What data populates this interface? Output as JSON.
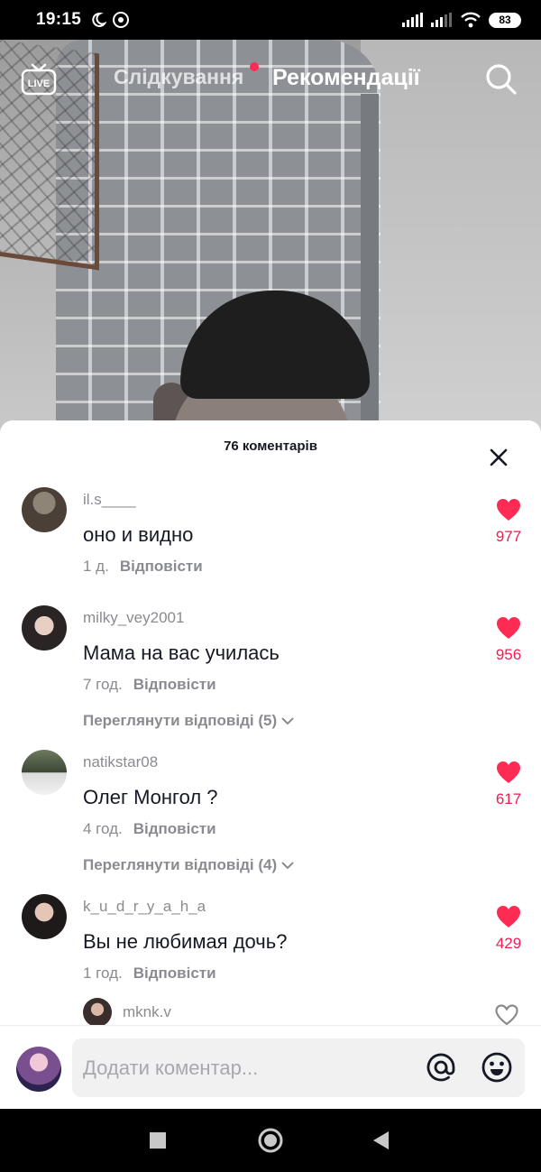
{
  "status_bar": {
    "time": "19:15",
    "battery": "83"
  },
  "feed": {
    "live_label": "LIVE",
    "tab_following": "Слідкування",
    "tab_for_you": "Рекомендації"
  },
  "comments_sheet": {
    "title": "76 коментарів",
    "comments": [
      {
        "username": "il.s____",
        "text": "оно и видно",
        "time": "1 д.",
        "reply_label": "Відповісти",
        "likes": "977",
        "view_replies": ""
      },
      {
        "username": "milky_vey2001",
        "text": "Мама на вас училась",
        "time": "7 год.",
        "reply_label": "Відповісти",
        "likes": "956",
        "view_replies": "Переглянути відповіді (5)"
      },
      {
        "username": "natikstar08",
        "text": "Олег Монгол ?",
        "time": "4 год.",
        "reply_label": "Відповісти",
        "likes": "617",
        "view_replies": "Переглянути відповіді (4)"
      },
      {
        "username": "k_u_d_r_y_a_h_a",
        "text": "Вы не любимая дочь?",
        "time": "1 год.",
        "reply_label": "Відповісти",
        "likes": "429",
        "view_replies": ""
      }
    ],
    "reply_preview": {
      "username": "mknk.v"
    },
    "input_placeholder": "Додати коментар..."
  },
  "colors": {
    "accent": "#fe2c55",
    "like": "#ee1d52",
    "muted": "#8a8b91"
  }
}
